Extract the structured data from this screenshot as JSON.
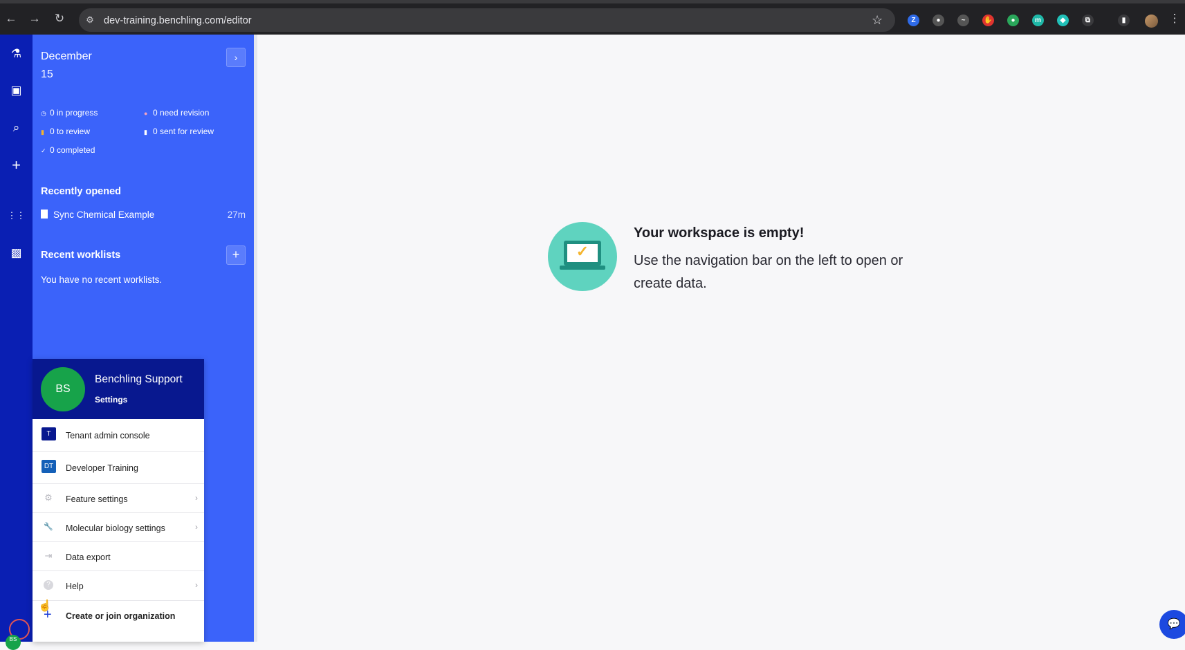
{
  "browser": {
    "url": "dev-training.benchling.com/editor",
    "back_icon": "←",
    "forward_icon": "→",
    "reload_icon": "↻",
    "tune_icon": "⚙",
    "star_icon": "☆",
    "extensions": [
      {
        "name": "z-extension-icon",
        "glyph": "Z",
        "color": "#2f6be8"
      },
      {
        "name": "circle-extension-icon",
        "glyph": "●",
        "color": "#555555"
      },
      {
        "name": "wave-extension-icon",
        "glyph": "~",
        "color": "#555555"
      },
      {
        "name": "hand-extension-icon",
        "glyph": "✋",
        "color": "#e0342f"
      },
      {
        "name": "green-extension-icon",
        "glyph": "●",
        "color": "#2aa75b"
      },
      {
        "name": "m-extension-icon",
        "glyph": "m",
        "color": "#1fb8a8"
      },
      {
        "name": "diamond-extension-icon",
        "glyph": "◆",
        "color": "#21c0b8"
      },
      {
        "name": "puzzle-extension-icon",
        "glyph": "⧉",
        "color": "#3a3a3d"
      },
      {
        "name": "sidepanel-icon",
        "glyph": "▮",
        "color": "#3a3a3d"
      }
    ],
    "menu_icon": "⋮"
  },
  "rail": {
    "items": [
      {
        "name": "benchling-logo-icon",
        "glyph": "⚗"
      },
      {
        "name": "briefcase-icon",
        "glyph": "▣"
      },
      {
        "name": "search-icon",
        "glyph": "⌕"
      },
      {
        "name": "create-plus-icon",
        "glyph": "+"
      },
      {
        "name": "apps-grid-icon",
        "glyph": "⋮⋮"
      },
      {
        "name": "camera-folder-icon",
        "glyph": "▩"
      }
    ]
  },
  "panel": {
    "date_month": "December",
    "date_day": "15",
    "expand_icon": "›",
    "stats": [
      {
        "icon": "◷",
        "label": "0 in progress",
        "icon_color": "#ffffff"
      },
      {
        "icon": "●",
        "label": "0 need revision",
        "icon_color": "#f4a3c0"
      },
      {
        "icon": "▮",
        "label": "0 to review",
        "icon_color": "#f5b52e"
      },
      {
        "icon": "▮",
        "label": "0 sent for review",
        "icon_color": "#ffffff"
      },
      {
        "icon": "✓",
        "label": "0 completed",
        "icon_color": "#ffffff"
      }
    ],
    "recently_opened_title": "Recently opened",
    "recent_items": [
      {
        "label": "Sync Chemical Example",
        "time": "27m"
      }
    ],
    "recent_worklists_title": "Recent worklists",
    "add_icon": "+",
    "no_worklists_text": "You have no recent worklists."
  },
  "user_menu": {
    "avatar_initials": "BS",
    "user_name": "Benchling Support",
    "settings_label": "Settings",
    "items": [
      {
        "label": "Tenant admin console",
        "tile": "T",
        "tile_color": "#08188f",
        "chevron": ""
      },
      {
        "label": "Developer Training",
        "tile": "DT",
        "tile_color": "#1460b8",
        "chevron": ""
      },
      {
        "label": "Feature settings",
        "icon": "⚙",
        "chevron": "›"
      },
      {
        "label": "Molecular biology settings",
        "icon": "🔧",
        "chevron": "›"
      },
      {
        "label": "Data export",
        "icon": "⇥",
        "chevron": ""
      },
      {
        "label": "Help",
        "icon": "?",
        "chevron": "›"
      },
      {
        "label": "Create or join organization",
        "icon": "+",
        "chevron": ""
      }
    ]
  },
  "bottom": {
    "avatar_initials": "BS"
  },
  "main": {
    "empty_title": "Your workspace is empty!",
    "empty_desc": "Use the navigation bar on the left to open or create data.",
    "check_glyph": "✓"
  },
  "chat": {
    "icon": "💬"
  }
}
